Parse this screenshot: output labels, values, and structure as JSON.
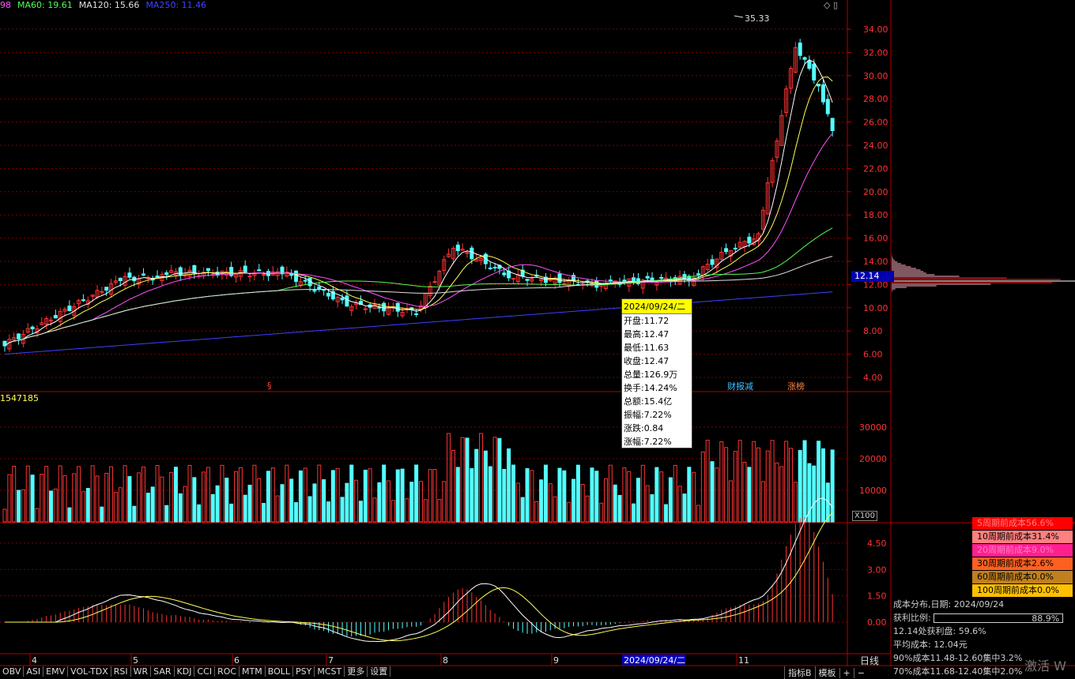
{
  "ma_legend": [
    {
      "label": "98",
      "color": "#ff50ff"
    },
    {
      "label": "MA60: 19.61",
      "color": "#50ff50"
    },
    {
      "label": "MA120: 15.66",
      "color": "#e0e0e0"
    },
    {
      "label": "MA250: 11.46",
      "color": "#4040ff"
    }
  ],
  "top_icons": "◇ ▯",
  "price_axis": [
    "34.00",
    "32.00",
    "30.00",
    "28.00",
    "26.00",
    "24.00",
    "22.00",
    "20.00",
    "18.00",
    "16.00",
    "14.00",
    "12.00",
    "10.00",
    "8.00",
    "6.00",
    "4.00"
  ],
  "high_marker": "35.33",
  "current_price": "12.14",
  "volume_label": "1547185",
  "volume_axis": [
    "30000",
    "20000",
    "10000"
  ],
  "volume_unit": "X100",
  "macd_axis": [
    "4.50",
    "3.00",
    "1.50",
    "0.00"
  ],
  "date_axis": [
    {
      "label": "4"
    },
    {
      "label": "5"
    },
    {
      "label": "6"
    },
    {
      "label": "7"
    },
    {
      "label": "8"
    },
    {
      "label": "9"
    },
    {
      "label": "11"
    }
  ],
  "date_cursor": "2024/09/24/二",
  "period": "日线",
  "tags": {
    "s_marker": "§",
    "financial": "财报减",
    "limit_board": "涨榜"
  },
  "tooltip": {
    "date": "2024/09/24/二",
    "rows": [
      "开盘:11.72",
      "最高:12.47",
      "最低:11.63",
      "收盘:12.47",
      "总量:126.9万",
      "换手:14.24%",
      "总额:15.4亿",
      "振幅:7.22%",
      "涨跌:0.84",
      "涨幅:7.22%"
    ]
  },
  "cost_periods": [
    {
      "label": "5周期前成本56.6%",
      "color": "#ff0000",
      "text": "#ff8080"
    },
    {
      "label": "10周期前成本31.4%",
      "color": "#ff8080",
      "text": "#000000"
    },
    {
      "label": "20周期前成本9.0%",
      "color": "#ff2090",
      "text": "#ff80c0"
    },
    {
      "label": "30周期前成本2.6%",
      "color": "#ff6020",
      "text": "#000000"
    },
    {
      "label": "60周期前成本0.0%",
      "color": "#c08020",
      "text": "#000000"
    },
    {
      "label": "100周期前成本0.0%",
      "color": "#ffc000",
      "text": "#000000"
    }
  ],
  "cost_info": {
    "date_line": "成本分布,日期: 2024/09/24",
    "profit_label": "获利比例:",
    "profit_value": "88.9%",
    "profit_at": "12.14处获利盘: 59.6%",
    "avg_cost": "平均成本: 12.04元",
    "c90": "90%成本11.48-12.60集中3.2%",
    "c70": "70%成本11.68-12.40集中2.0%"
  },
  "bottom_tabs": [
    "OBV",
    "ASI",
    "EMV",
    "VOL-TDX",
    "RSI",
    "WR",
    "SAR",
    "KDJ",
    "CCI",
    "ROC",
    "MTM",
    "BOLL",
    "PSY",
    "MCST",
    "更多",
    "设置"
  ],
  "right_tabs": [
    "指标B",
    "模板",
    "+",
    "−"
  ],
  "watermark": "激活 W"
}
